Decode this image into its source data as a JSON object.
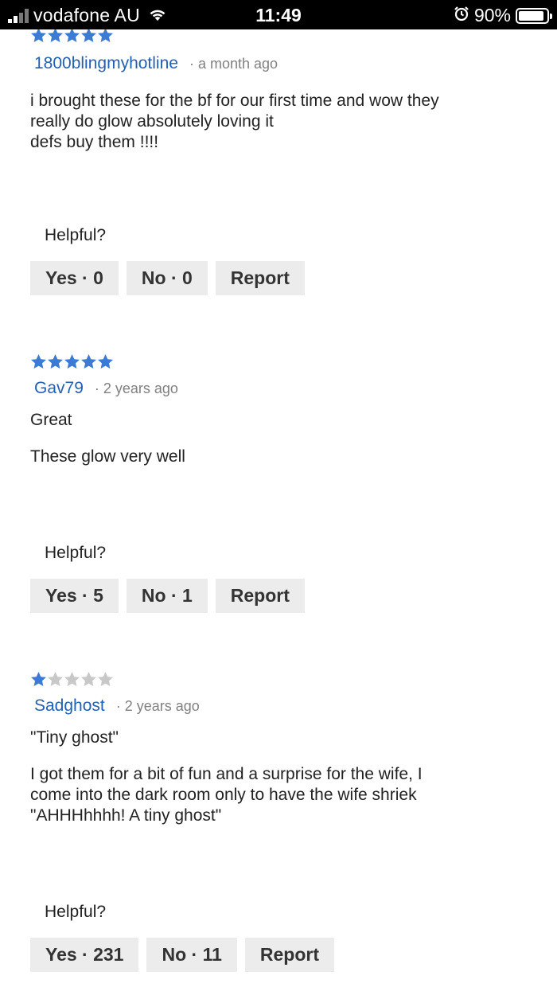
{
  "status_bar": {
    "carrier": "vodafone AU",
    "time": "11:49",
    "battery": "90%",
    "battery_level": 0.9
  },
  "helpful_label": "Helpful?",
  "report_label": "Report",
  "reviews": [
    {
      "rating": 5,
      "author": "1800blingmyhotline",
      "time": "· a month ago",
      "title": "",
      "body": "i brought these for the bf for our first time and wow they\nreally do glow absolutely loving it\ndefs buy them !!!!",
      "yes_label": "Yes · 0",
      "no_label": "No · 0"
    },
    {
      "rating": 5,
      "author": "Gav79",
      "time": "· 2 years ago",
      "title": "Great",
      "body": "These glow very well",
      "yes_label": "Yes · 5",
      "no_label": "No · 1"
    },
    {
      "rating": 1,
      "author": "Sadghost",
      "time": "· 2 years ago",
      "title": "\"Tiny ghost\"",
      "body": "I got them for a bit of fun and a surprise for the wife, I\ncome into the dark room only to have the wife shriek\n\"AHHHhhhh! A tiny ghost\"",
      "yes_label": "Yes · 231",
      "no_label": "No · 11"
    }
  ],
  "colors": {
    "star_filled": "#3b7bd4",
    "star_empty": "#c8c8c8",
    "author_link": "#2160b5",
    "button_bg": "#ececec"
  },
  "icons": {
    "signal": "signal-strength-icon",
    "wifi": "wifi-icon",
    "alarm": "alarm-clock-icon",
    "battery": "battery-icon",
    "star": "star-icon"
  }
}
